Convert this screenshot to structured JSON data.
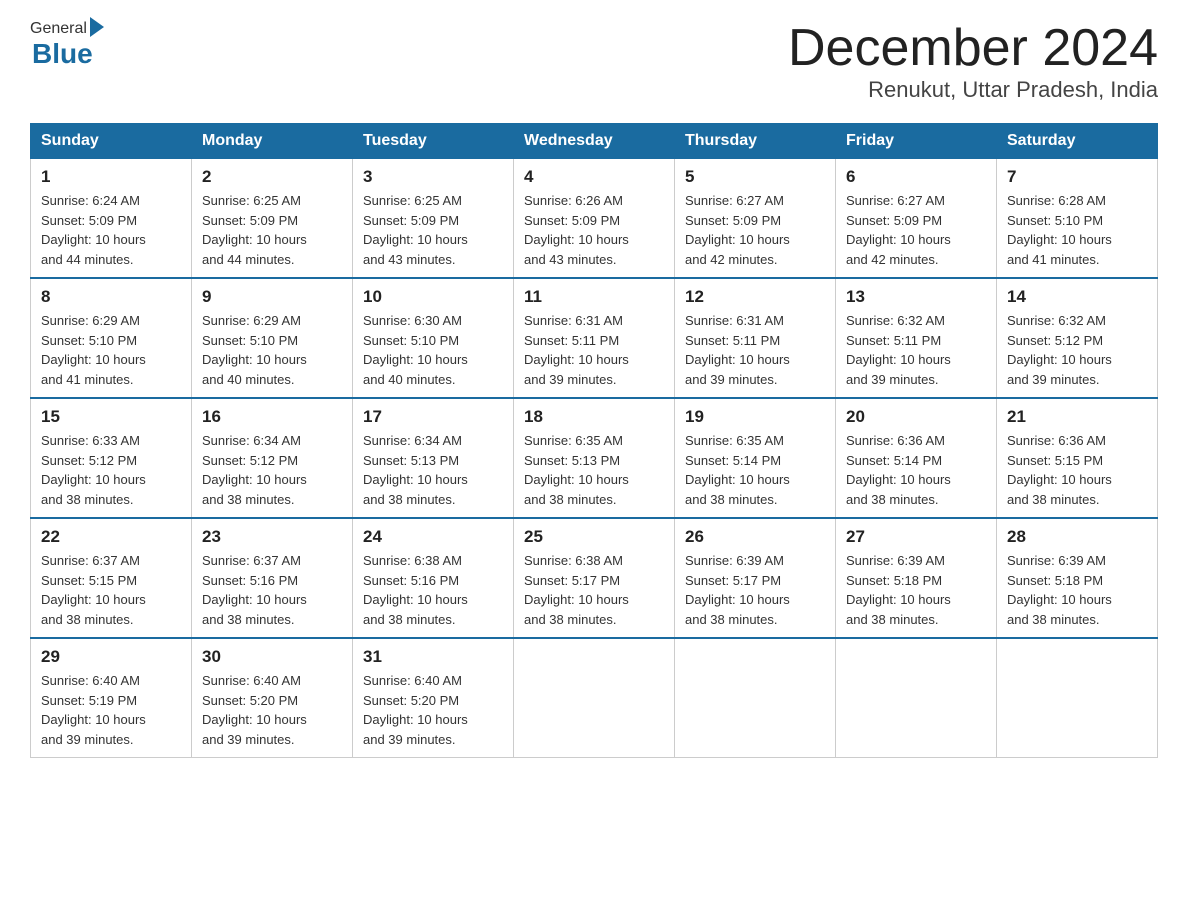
{
  "header": {
    "logo_general": "General",
    "logo_blue": "Blue",
    "month_title": "December 2024",
    "location": "Renukut, Uttar Pradesh, India"
  },
  "days_of_week": [
    "Sunday",
    "Monday",
    "Tuesday",
    "Wednesday",
    "Thursday",
    "Friday",
    "Saturday"
  ],
  "weeks": [
    [
      {
        "day": "1",
        "sunrise": "6:24 AM",
        "sunset": "5:09 PM",
        "daylight": "10 hours and 44 minutes."
      },
      {
        "day": "2",
        "sunrise": "6:25 AM",
        "sunset": "5:09 PM",
        "daylight": "10 hours and 44 minutes."
      },
      {
        "day": "3",
        "sunrise": "6:25 AM",
        "sunset": "5:09 PM",
        "daylight": "10 hours and 43 minutes."
      },
      {
        "day": "4",
        "sunrise": "6:26 AM",
        "sunset": "5:09 PM",
        "daylight": "10 hours and 43 minutes."
      },
      {
        "day": "5",
        "sunrise": "6:27 AM",
        "sunset": "5:09 PM",
        "daylight": "10 hours and 42 minutes."
      },
      {
        "day": "6",
        "sunrise": "6:27 AM",
        "sunset": "5:09 PM",
        "daylight": "10 hours and 42 minutes."
      },
      {
        "day": "7",
        "sunrise": "6:28 AM",
        "sunset": "5:10 PM",
        "daylight": "10 hours and 41 minutes."
      }
    ],
    [
      {
        "day": "8",
        "sunrise": "6:29 AM",
        "sunset": "5:10 PM",
        "daylight": "10 hours and 41 minutes."
      },
      {
        "day": "9",
        "sunrise": "6:29 AM",
        "sunset": "5:10 PM",
        "daylight": "10 hours and 40 minutes."
      },
      {
        "day": "10",
        "sunrise": "6:30 AM",
        "sunset": "5:10 PM",
        "daylight": "10 hours and 40 minutes."
      },
      {
        "day": "11",
        "sunrise": "6:31 AM",
        "sunset": "5:11 PM",
        "daylight": "10 hours and 39 minutes."
      },
      {
        "day": "12",
        "sunrise": "6:31 AM",
        "sunset": "5:11 PM",
        "daylight": "10 hours and 39 minutes."
      },
      {
        "day": "13",
        "sunrise": "6:32 AM",
        "sunset": "5:11 PM",
        "daylight": "10 hours and 39 minutes."
      },
      {
        "day": "14",
        "sunrise": "6:32 AM",
        "sunset": "5:12 PM",
        "daylight": "10 hours and 39 minutes."
      }
    ],
    [
      {
        "day": "15",
        "sunrise": "6:33 AM",
        "sunset": "5:12 PM",
        "daylight": "10 hours and 38 minutes."
      },
      {
        "day": "16",
        "sunrise": "6:34 AM",
        "sunset": "5:12 PM",
        "daylight": "10 hours and 38 minutes."
      },
      {
        "day": "17",
        "sunrise": "6:34 AM",
        "sunset": "5:13 PM",
        "daylight": "10 hours and 38 minutes."
      },
      {
        "day": "18",
        "sunrise": "6:35 AM",
        "sunset": "5:13 PM",
        "daylight": "10 hours and 38 minutes."
      },
      {
        "day": "19",
        "sunrise": "6:35 AM",
        "sunset": "5:14 PM",
        "daylight": "10 hours and 38 minutes."
      },
      {
        "day": "20",
        "sunrise": "6:36 AM",
        "sunset": "5:14 PM",
        "daylight": "10 hours and 38 minutes."
      },
      {
        "day": "21",
        "sunrise": "6:36 AM",
        "sunset": "5:15 PM",
        "daylight": "10 hours and 38 minutes."
      }
    ],
    [
      {
        "day": "22",
        "sunrise": "6:37 AM",
        "sunset": "5:15 PM",
        "daylight": "10 hours and 38 minutes."
      },
      {
        "day": "23",
        "sunrise": "6:37 AM",
        "sunset": "5:16 PM",
        "daylight": "10 hours and 38 minutes."
      },
      {
        "day": "24",
        "sunrise": "6:38 AM",
        "sunset": "5:16 PM",
        "daylight": "10 hours and 38 minutes."
      },
      {
        "day": "25",
        "sunrise": "6:38 AM",
        "sunset": "5:17 PM",
        "daylight": "10 hours and 38 minutes."
      },
      {
        "day": "26",
        "sunrise": "6:39 AM",
        "sunset": "5:17 PM",
        "daylight": "10 hours and 38 minutes."
      },
      {
        "day": "27",
        "sunrise": "6:39 AM",
        "sunset": "5:18 PM",
        "daylight": "10 hours and 38 minutes."
      },
      {
        "day": "28",
        "sunrise": "6:39 AM",
        "sunset": "5:18 PM",
        "daylight": "10 hours and 38 minutes."
      }
    ],
    [
      {
        "day": "29",
        "sunrise": "6:40 AM",
        "sunset": "5:19 PM",
        "daylight": "10 hours and 39 minutes."
      },
      {
        "day": "30",
        "sunrise": "6:40 AM",
        "sunset": "5:20 PM",
        "daylight": "10 hours and 39 minutes."
      },
      {
        "day": "31",
        "sunrise": "6:40 AM",
        "sunset": "5:20 PM",
        "daylight": "10 hours and 39 minutes."
      },
      null,
      null,
      null,
      null
    ]
  ],
  "labels": {
    "sunrise": "Sunrise:",
    "sunset": "Sunset:",
    "daylight": "Daylight:"
  }
}
